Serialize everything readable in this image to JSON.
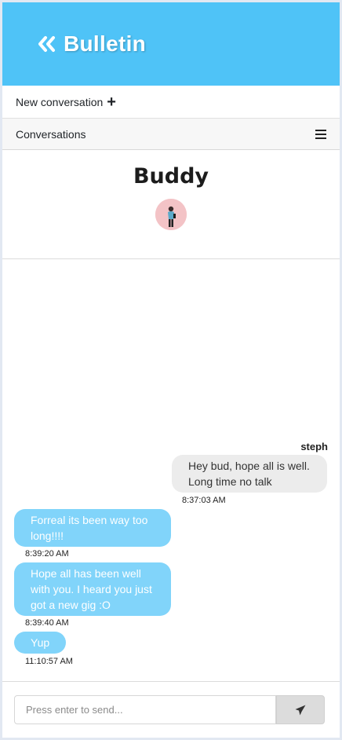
{
  "header": {
    "title": "Bulletin",
    "back_icon": "double-chevron-left-icon"
  },
  "new_conversation": {
    "label": "New conversation",
    "icon": "plus-icon"
  },
  "conversations_bar": {
    "label": "Conversations",
    "menu_icon": "hamburger-icon"
  },
  "chat": {
    "name": "Buddy"
  },
  "messages": [
    {
      "sender": "steph",
      "direction": "outgoing",
      "lines": [
        "Hey bud, hope all is well.",
        "Long time no talk"
      ],
      "time": "8:37:03 AM"
    },
    {
      "direction": "incoming",
      "lines": [
        "Forreal its been way too",
        "long!!!!"
      ],
      "time": "8:39:20 AM"
    },
    {
      "direction": "incoming",
      "lines": [
        "Hope all has been well",
        "with you. I heard you just",
        "got a new gig :O"
      ],
      "time": "8:39:40 AM"
    },
    {
      "direction": "incoming",
      "lines": [
        "Yup"
      ],
      "time": "11:10:57 AM"
    }
  ],
  "composer": {
    "placeholder": "Press enter to send...",
    "send_icon": "paper-plane-icon"
  },
  "colors": {
    "header": "#4fc3f7",
    "incoming_bubble": "#81d4fa",
    "outgoing_bubble": "#ececec"
  }
}
